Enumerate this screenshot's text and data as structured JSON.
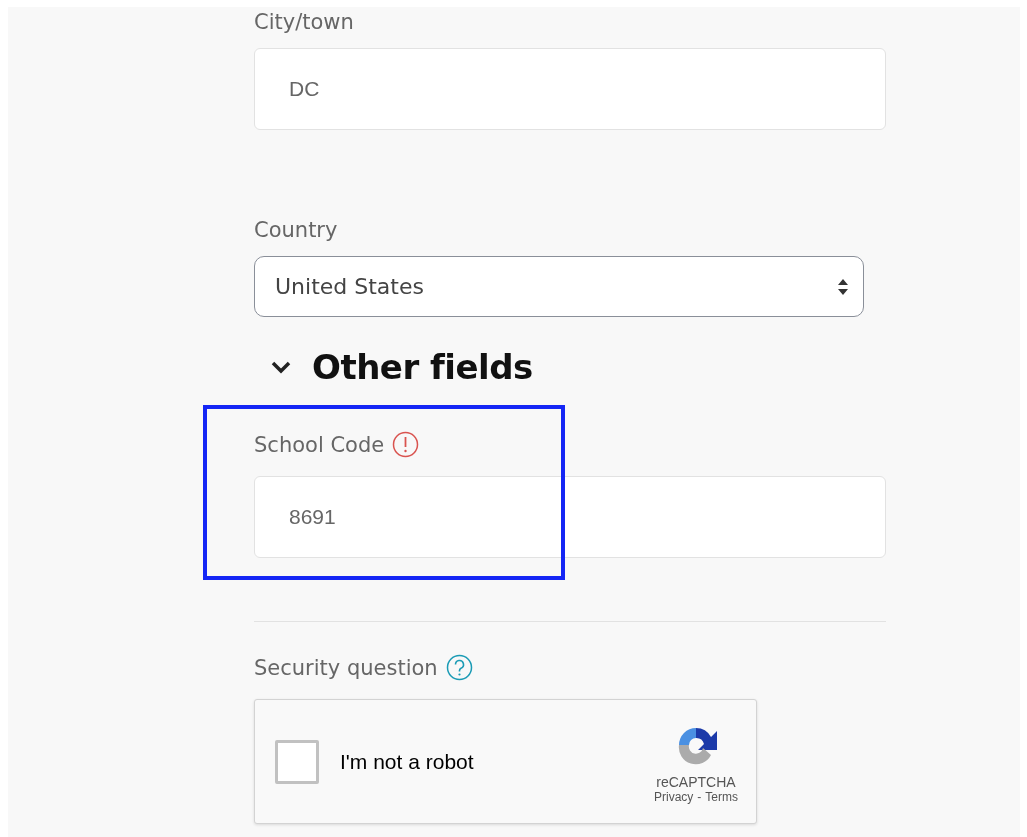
{
  "fields": [
    {
      "kind": "text",
      "label": "City/town",
      "value": "DC"
    },
    {
      "kind": "select",
      "label": "Country",
      "value": "United States"
    }
  ],
  "section": {
    "title": "Other fields",
    "expanded": true,
    "fields": [
      {
        "kind": "text",
        "label": "School Code",
        "value": "8691",
        "required": true,
        "highlighted": true
      }
    ]
  },
  "security": {
    "label": "Security question",
    "captcha": {
      "checked": false,
      "label": "I'm not a robot",
      "brand": "reCAPTCHA",
      "privacy": "Privacy",
      "separator": "-",
      "terms": "Terms"
    }
  }
}
